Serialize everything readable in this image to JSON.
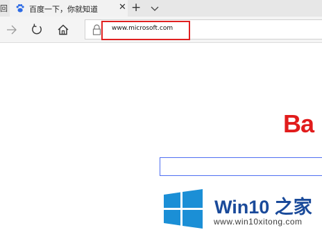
{
  "tabs": {
    "left_fragment": "回",
    "active": {
      "title": "百度一下，你就知道",
      "close": "✕"
    },
    "new_tab": "+",
    "tab_list": "chevron-down-icon"
  },
  "nav": {
    "icons": [
      "forward-arrow-icon",
      "refresh-icon",
      "home-icon"
    ],
    "address": {
      "lock_icon": "lock-icon",
      "url": "www.microsoft.com"
    }
  },
  "page": {
    "logo_text": "Ba",
    "logo_color": "#e11c1c",
    "search_border_color": "#4e6ef2"
  },
  "watermark": {
    "brand": "Win10 之家",
    "url": "www.win10xitong.com",
    "brand_color": "#1a4a9a",
    "logo_color": "#1b8fd6"
  },
  "annotation": {
    "highlight_color": "#e02020"
  }
}
